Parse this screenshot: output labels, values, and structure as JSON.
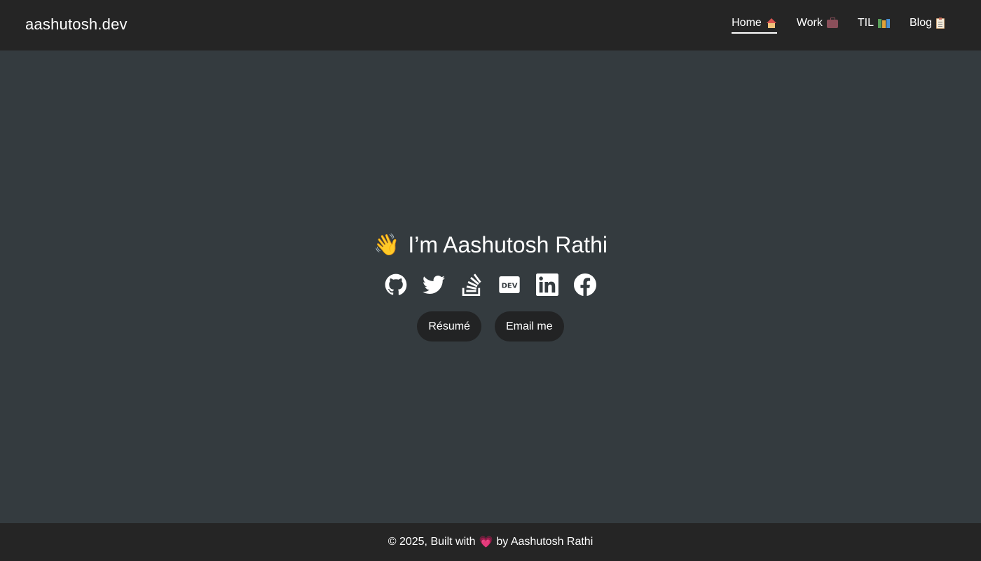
{
  "header": {
    "brand": "aashutosh.dev",
    "nav": [
      {
        "label": "Home",
        "icon": "house-icon",
        "active": true
      },
      {
        "label": "Work",
        "icon": "briefcase-icon",
        "active": false
      },
      {
        "label": "TIL",
        "icon": "books-icon",
        "active": false
      },
      {
        "label": "Blog",
        "icon": "clipboard-icon",
        "active": false
      }
    ]
  },
  "hero": {
    "wave_emoji": "👋",
    "greeting": "I’m Aashutosh Rathi",
    "socials": [
      {
        "name": "github-icon"
      },
      {
        "name": "twitter-icon"
      },
      {
        "name": "stackoverflow-icon"
      },
      {
        "name": "dev-to-icon"
      },
      {
        "name": "linkedin-icon"
      },
      {
        "name": "facebook-icon"
      }
    ],
    "buttons": {
      "resume": "Résumé",
      "email": "Email me"
    }
  },
  "footer": {
    "prefix": "© 2025, Built with",
    "heart": "💗",
    "suffix": "by Aashutosh Rathi"
  },
  "colors": {
    "header_bg": "#252525",
    "body_bg": "#343b3f",
    "button_bg": "#222324",
    "heart": "#ff4f84"
  }
}
